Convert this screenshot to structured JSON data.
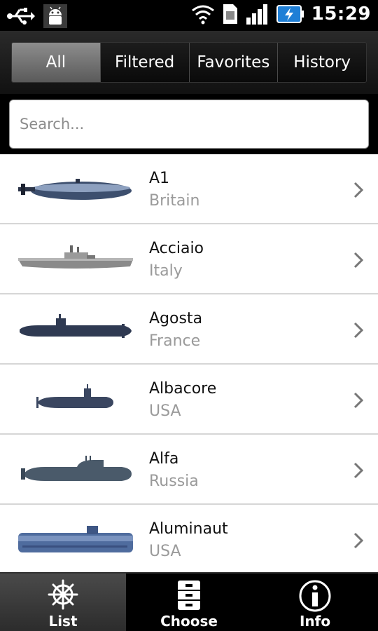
{
  "status_bar": {
    "time": "15:29",
    "icons": [
      "usb-icon",
      "android-debug-icon",
      "wifi-icon",
      "sim-icon",
      "signal-icon",
      "battery-charging-icon"
    ]
  },
  "tabs": [
    {
      "label": "All",
      "active": true
    },
    {
      "label": "Filtered",
      "active": false
    },
    {
      "label": "Favorites",
      "active": false
    },
    {
      "label": "History",
      "active": false
    }
  ],
  "search": {
    "placeholder": "Search..."
  },
  "submarines": [
    {
      "name": "A1",
      "country": "Britain"
    },
    {
      "name": "Acciaio",
      "country": "Italy"
    },
    {
      "name": "Agosta",
      "country": "France"
    },
    {
      "name": "Albacore",
      "country": "USA"
    },
    {
      "name": "Alfa",
      "country": "Russia"
    },
    {
      "name": "Aluminaut",
      "country": "USA"
    }
  ],
  "bottom_tabs": [
    {
      "label": "List",
      "icon": "ship-wheel-icon",
      "active": true
    },
    {
      "label": "Choose",
      "icon": "filing-cabinet-icon",
      "active": false
    },
    {
      "label": "Info",
      "icon": "info-icon",
      "active": false
    }
  ],
  "colors": {
    "active_tab": "#7a7a7a",
    "secondary_text": "#9a9a9a",
    "divider": "#d6d6d6"
  }
}
